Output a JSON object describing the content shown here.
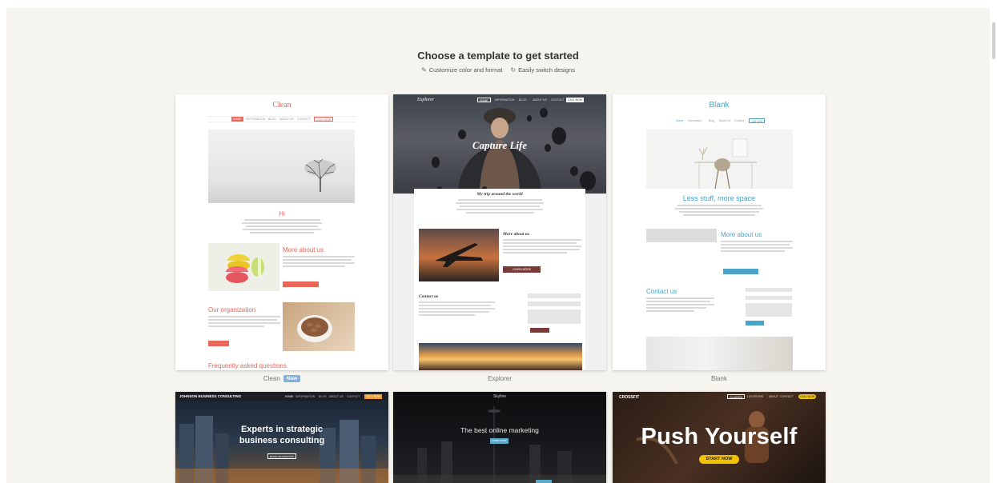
{
  "header": {
    "title": "Choose a template to get started",
    "features": [
      {
        "icon": "pencil-icon",
        "label": "Customize color and format"
      },
      {
        "icon": "refresh-icon",
        "label": "Easily switch designs"
      }
    ]
  },
  "templates": [
    {
      "name": "Clean",
      "badge": "New",
      "preview": {
        "title": "Clean",
        "nav": [
          "HOME",
          "INFORMATION",
          "BLOG",
          "ABOUT US",
          "CONTACT",
          "CALL NOW"
        ],
        "hi": "Hi",
        "section1": "More about us",
        "section2": "Our organization",
        "section3": "Frequently asked questions"
      }
    },
    {
      "name": "Explorer",
      "preview": {
        "logo": "Explorer",
        "nav": [
          "HOME",
          "INFORMATION",
          "BLOG",
          "ABOUT US",
          "CONTACT",
          "CALL NOW"
        ],
        "hero": "Capture Life",
        "section1": "My trip around the world",
        "section2": "More about us",
        "section3": "Contact us",
        "button": "LEARN MORE"
      }
    },
    {
      "name": "Blank",
      "preview": {
        "title": "Blank",
        "nav": [
          "Home",
          "Information",
          "Blog",
          "About Us",
          "Contact",
          "Call Now"
        ],
        "headline": "Less stuff, more space",
        "section1": "More about us",
        "section2": "Contact us"
      }
    },
    {
      "name": "Johnson Business Consulting",
      "preview": {
        "logo": "JOHNSON BUSINESS CONSULTING",
        "nav": [
          "HOME",
          "INFORMATION",
          "BLOG",
          "ABOUT US",
          "CONTACT",
          "CALL NOW"
        ],
        "hero_line1": "Experts in strategic",
        "hero_line2": "business consulting",
        "button": "MORE INFORMATION"
      }
    },
    {
      "name": "Skyline",
      "preview": {
        "logo": "Skyline",
        "hero": "The best online marketing",
        "button": "Learn more"
      }
    },
    {
      "name": "Crossfit",
      "preview": {
        "logo": "CROSSFIT",
        "nav": [
          "CLASSES",
          "LOCATIONS",
          "ABOUT",
          "CONTACT",
          "CALL NOW"
        ],
        "hero": "Push Yourself",
        "button": "START NOW"
      }
    }
  ],
  "colors": {
    "background": "#f5f4ef",
    "clean_accent": "#e8665a",
    "blank_accent": "#4aa3c9",
    "badge": "#82b0d8",
    "crossfit_accent": "#f2c200"
  }
}
